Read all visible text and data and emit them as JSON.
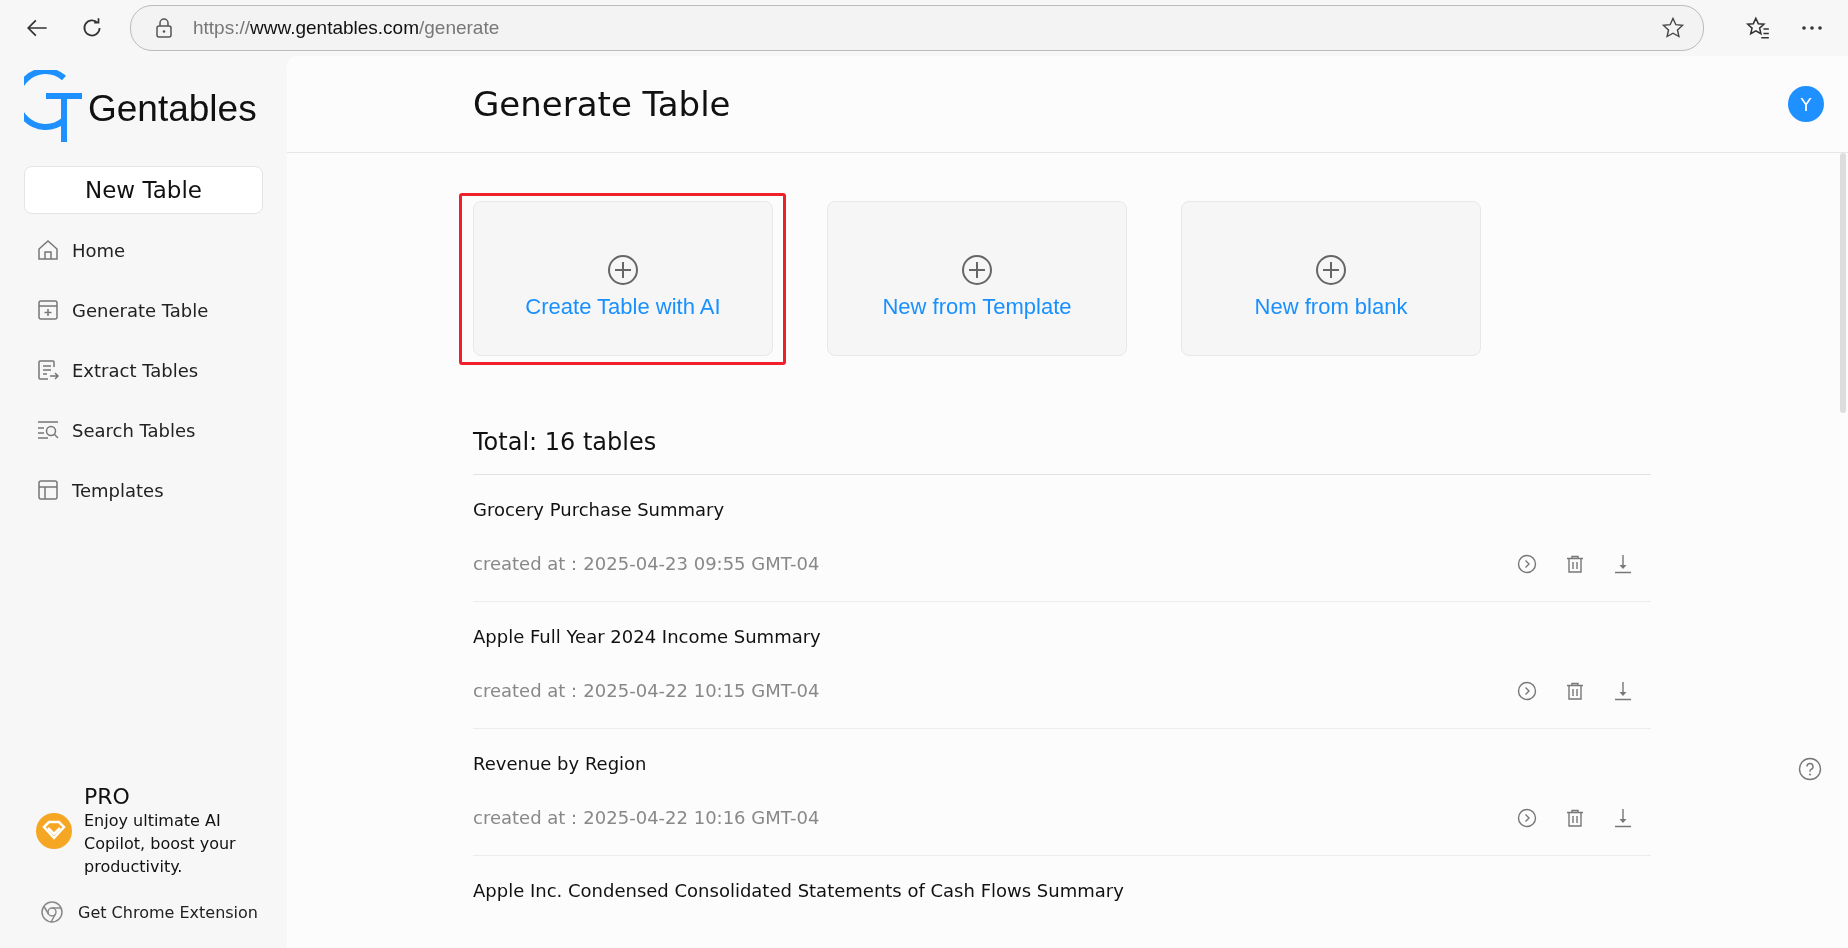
{
  "browser": {
    "url_scheme": "https://",
    "url_host": "www.gentables.com",
    "url_path": "/generate"
  },
  "sidebar": {
    "brand": "Gentables",
    "new_button": "New Table",
    "items": [
      {
        "label": "Home",
        "selected": false
      },
      {
        "label": "Generate Table",
        "selected": false
      },
      {
        "label": "Extract Tables",
        "selected": false
      },
      {
        "label": "Search Tables",
        "selected": false
      },
      {
        "label": "Templates",
        "selected": false
      }
    ],
    "pro": {
      "title": "PRO",
      "text": "Enjoy ultimate AI Copilot, boost your productivity."
    },
    "extension_link": "Get Chrome Extension"
  },
  "header": {
    "title": "Generate Table",
    "avatar": "Y"
  },
  "cards": [
    {
      "label": "Create Table with AI",
      "highlighted": true
    },
    {
      "label": "New from Template",
      "highlighted": false
    },
    {
      "label": "New from blank",
      "highlighted": false
    }
  ],
  "total": "Total: 16 tables",
  "tables": [
    {
      "title": "Grocery Purchase Summary",
      "created_label": "created at：",
      "created": "2025-04-23 09:55 GMT-04"
    },
    {
      "title": "Apple Full Year 2024 Income Summary",
      "created_label": "created at：",
      "created": "2025-04-22 10:15 GMT-04"
    },
    {
      "title": "Revenue by Region",
      "created_label": "created at：",
      "created": "2025-04-22 10:16 GMT-04"
    },
    {
      "title": "Apple Inc. Condensed Consolidated Statements of Cash Flows Summary"
    }
  ]
}
